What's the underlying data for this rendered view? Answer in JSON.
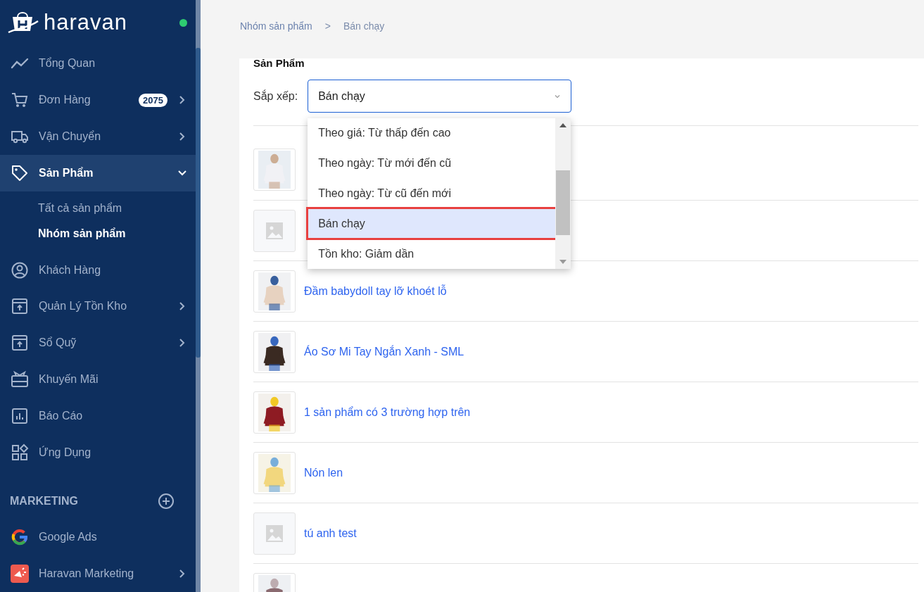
{
  "sidebar": {
    "logo": "haravan",
    "online": true,
    "items": [
      {
        "label": "Tổng Quan",
        "selected": false
      },
      {
        "label": "Đơn Hàng",
        "badge": "2075",
        "expanded": false,
        "selected": false
      },
      {
        "label": "Vận Chuyển",
        "expanded": false,
        "selected": false
      },
      {
        "label": "Sản Phẩm",
        "expanded": true,
        "selected": true,
        "children": [
          {
            "label": "Tất cả sản phẩm",
            "selected": false
          },
          {
            "label": "Nhóm sản phẩm",
            "selected": true
          }
        ]
      },
      {
        "label": "Khách Hàng",
        "selected": false
      },
      {
        "label": "Quản Lý Tồn Kho",
        "expanded": false,
        "selected": false
      },
      {
        "label": "Sổ Quỹ",
        "expanded": false,
        "selected": false
      },
      {
        "label": "Khuyến Mãi",
        "selected": false
      },
      {
        "label": "Báo Cáo",
        "selected": false
      },
      {
        "label": "Ứng Dụng",
        "selected": false
      }
    ],
    "section": {
      "title": "MARKETING",
      "items": [
        {
          "label": "Google Ads",
          "selected": false
        },
        {
          "label": "Haravan Marketing",
          "expanded": false,
          "selected": false
        }
      ]
    }
  },
  "breadcrumb": [
    "Nhóm sản phẩm",
    "Bán chạy"
  ],
  "breadcrumb_separator": ">",
  "card": {
    "title": "Sản Phẩm",
    "sort": {
      "label": "Sắp xếp:",
      "value": "Bán chạy",
      "expanded": true,
      "options": [
        {
          "label": "Theo giá: Từ thấp đến cao",
          "selected": false
        },
        {
          "label": "Theo ngày: Từ mới đến cũ",
          "selected": false
        },
        {
          "label": "Theo ngày: Từ cũ đến mới",
          "selected": false
        },
        {
          "label": "Bán chạy",
          "selected": true
        },
        {
          "label": "Tồn kho: Giảm dần",
          "selected": false
        }
      ]
    },
    "products": [
      {
        "kind": "picture"
      },
      {
        "kind": "placeholder"
      },
      {
        "name": "Đầm babydoll tay lỡ khoét lỗ",
        "kind": "picture"
      },
      {
        "name": "Áo Sơ Mi Tay Ngắn Xanh - SML",
        "kind": "picture"
      },
      {
        "name": "1 sản phẩm có 3 trường hợp trên",
        "kind": "picture"
      },
      {
        "name": "Nón len",
        "kind": "picture"
      },
      {
        "name": "tú anh test",
        "kind": "placeholder"
      },
      {
        "kind": "picture"
      }
    ]
  }
}
